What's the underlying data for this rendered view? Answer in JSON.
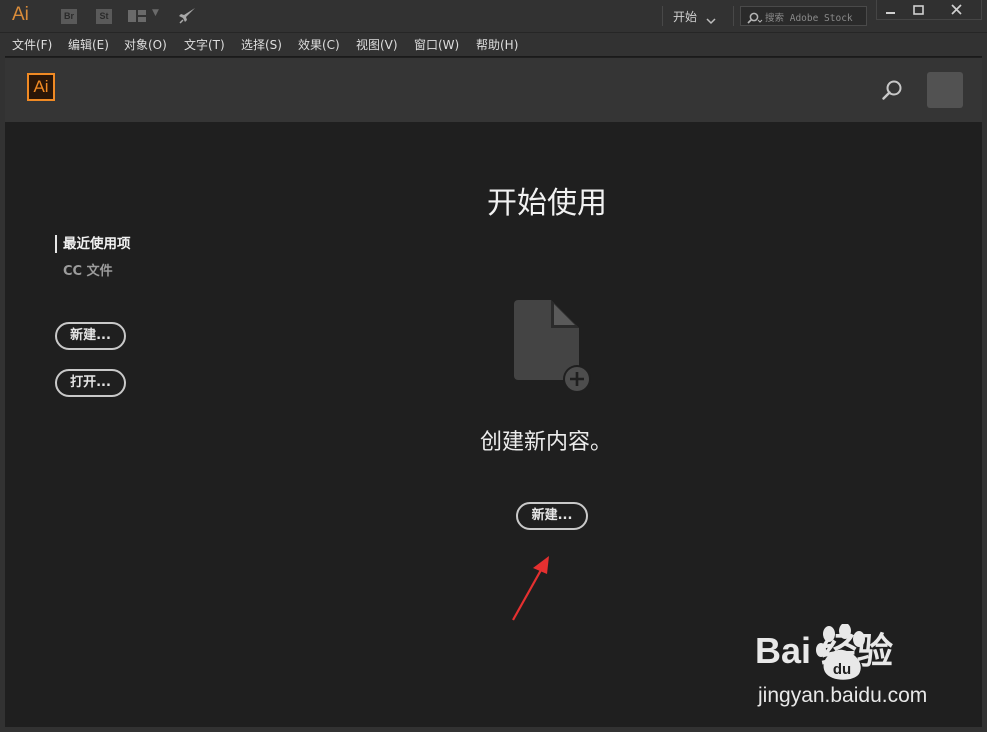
{
  "titlebar": {
    "app_logo": "Ai",
    "bridge_label": "Br",
    "stock_label": "St",
    "workspace": "开始",
    "search_placeholder": "搜索 Adobe Stock"
  },
  "menu": [
    "文件(F)",
    "编辑(E)",
    "对象(O)",
    "文字(T)",
    "选择(S)",
    "效果(C)",
    "视图(V)",
    "窗口(W)",
    "帮助(H)"
  ],
  "header": {
    "logo": "Ai"
  },
  "sidebar": {
    "recent": "最近使用项",
    "cc_files": "CC 文件",
    "new_button": "新建...",
    "open_button": "打开..."
  },
  "main": {
    "title": "开始使用",
    "create_text": "创建新内容。",
    "new_button": "新建..."
  },
  "watermark": {
    "brand": "Bai  经验",
    "du": "du",
    "url": "jingyan.baidu.com"
  },
  "colors": {
    "accent": "#f08a24",
    "annotation_arrow": "#e53030"
  }
}
